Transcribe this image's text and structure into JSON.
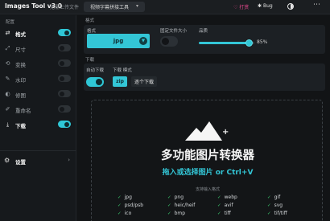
{
  "topbar": {
    "app_title": "Images Tool v3.0",
    "subtitle": "无需上传文件",
    "mode_select": "视频字幕拼接工具",
    "sponsor": "♡ 打赏",
    "bug": "Bug",
    "theme_icon": "theme-toggle-icon",
    "more_icon": "more-icon"
  },
  "sidebar": {
    "header": "配置",
    "items": [
      {
        "label": "格式",
        "icon": "⇄",
        "active": true,
        "toggle": true
      },
      {
        "label": "尺寸",
        "icon": "⤢",
        "active": false,
        "toggle": false
      },
      {
        "label": "变换",
        "icon": "⟲",
        "active": false,
        "toggle": false
      },
      {
        "label": "水印",
        "icon": "✎",
        "active": false,
        "toggle": false
      },
      {
        "label": "修图",
        "icon": "◐",
        "active": false,
        "toggle": false
      },
      {
        "label": "重命名",
        "icon": "✐",
        "active": false,
        "toggle": false
      },
      {
        "label": "下载",
        "icon": "⤓",
        "active": true,
        "toggle": true
      }
    ],
    "settings_label": "设置",
    "settings_icon": "⚙"
  },
  "format": {
    "section_title": "格式",
    "format_label": "格式",
    "format_value": "jpg",
    "fixed_size_label": "固定文件大小",
    "quality_label": "品质",
    "quality_value": "85%",
    "quality_fraction": 0.85
  },
  "download": {
    "section_title": "下载",
    "auto_label": "自动下载",
    "mode_label": "下载 模式",
    "mode_zip": "zip",
    "mode_nozip": "逐个下载"
  },
  "dropzone": {
    "title": "多功能图片转换器",
    "subtitle": "拖入或选择图片 or Ctrl+V",
    "supported_label": "支持输入格式",
    "formats": [
      [
        "jpg",
        "png",
        "webp",
        "gif"
      ],
      [
        "psd/psb",
        "heic/heif",
        "avif",
        "svg"
      ],
      [
        "ico",
        "bmp",
        "tiff",
        "tif/tiff"
      ]
    ]
  },
  "colors": {
    "accent": "#33c6d6",
    "check": "#3bd070",
    "sponsor": "#e0468b"
  }
}
